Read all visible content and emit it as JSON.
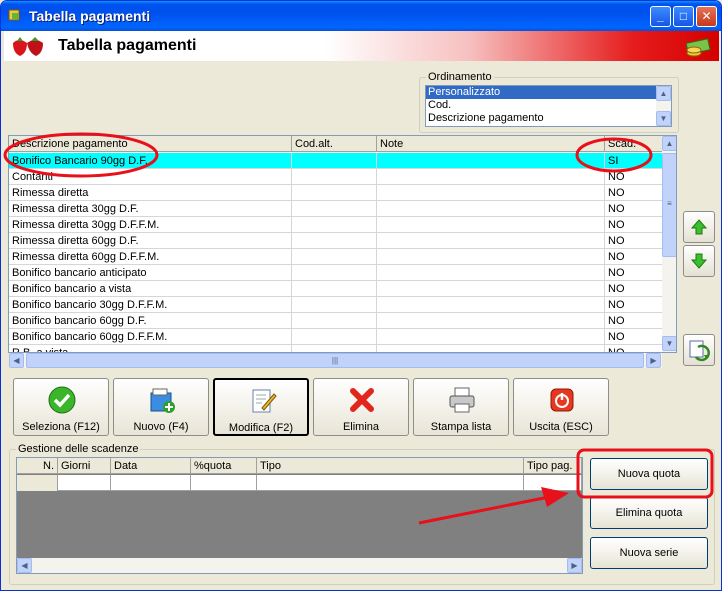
{
  "window": {
    "title": "Tabella pagamenti",
    "header_title": "Tabella pagamenti",
    "buttons": {
      "minimize": "_",
      "maximize": "□",
      "close": "✕"
    }
  },
  "ordinamento": {
    "legend": "Ordinamento",
    "options": [
      "Personalizzato",
      "Cod.",
      "Descrizione pagamento"
    ],
    "selected": "Personalizzato"
  },
  "payments_table": {
    "columns": [
      "Descrizione pagamento",
      "Cod.alt.",
      "Note",
      "Scad."
    ],
    "rows": [
      [
        "Bonifico Bancario 90gg D.F.",
        "",
        "",
        "SI"
      ],
      [
        "Contanti",
        "",
        "",
        "NO"
      ],
      [
        "Rimessa diretta",
        "",
        "",
        "NO"
      ],
      [
        "Rimessa diretta 30gg D.F.",
        "",
        "",
        "NO"
      ],
      [
        "Rimessa diretta 30gg D.F.F.M.",
        "",
        "",
        "NO"
      ],
      [
        "Rimessa diretta 60gg D.F.",
        "",
        "",
        "NO"
      ],
      [
        "Rimessa diretta 60gg D.F.F.M.",
        "",
        "",
        "NO"
      ],
      [
        "Bonifico bancario anticipato",
        "",
        "",
        "NO"
      ],
      [
        "Bonifico bancario a vista",
        "",
        "",
        "NO"
      ],
      [
        "Bonifico bancario 30gg D.F.F.M.",
        "",
        "",
        "NO"
      ],
      [
        "Bonifico bancario 60gg D.F.",
        "",
        "",
        "NO"
      ],
      [
        "Bonifico bancario 60gg D.F.F.M.",
        "",
        "",
        "NO"
      ],
      [
        "R.B. a vista",
        "",
        "",
        "NO"
      ]
    ],
    "selected_row": 0
  },
  "toolbar": {
    "seleziona": "Seleziona (F12)",
    "nuovo": "Nuovo (F4)",
    "modifica": "Modifica (F2)",
    "elimina": "Elimina",
    "stampa": "Stampa lista",
    "uscita": "Uscita (ESC)"
  },
  "scadenze": {
    "legend": "Gestione delle scadenze",
    "columns": [
      "N.",
      "Giorni",
      "Data",
      "%quota",
      "Tipo",
      "Tipo pag."
    ],
    "buttons": {
      "nuova_quota": "Nuova quota",
      "elimina_quota": "Elimina quota",
      "nuova_serie": "Nuova serie"
    }
  },
  "colors": {
    "selection_row": "#00ffff",
    "annotation": "#e8101a",
    "titlebar": "#0050ee"
  },
  "icons": [
    "app-icon",
    "strawberry-icon",
    "money-icon",
    "check-icon",
    "new-record-icon",
    "edit-icon",
    "delete-x-icon",
    "printer-icon",
    "exit-icon",
    "arrow-up-icon",
    "arrow-down-icon",
    "refresh-icon"
  ]
}
